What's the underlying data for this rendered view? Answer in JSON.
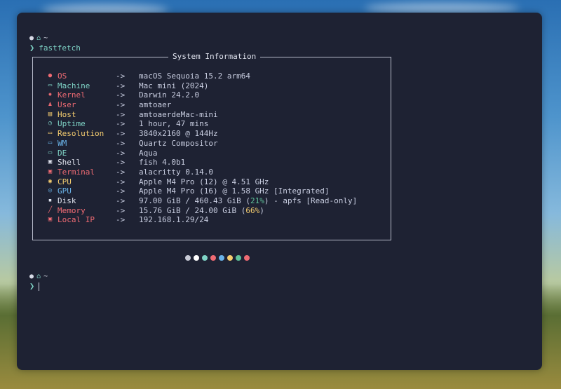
{
  "colors": {
    "terminal_bg": "#1e2233",
    "accent_teal": "#7fd3c6",
    "red": "#ef6b73",
    "yellow": "#f4cc6f",
    "blue": "#6ab3e8",
    "green": "#5fc29a"
  },
  "prompt1": {
    "icons": [
      "apple-icon",
      "home-icon"
    ],
    "dir": "~",
    "command": "fastfetch"
  },
  "box": {
    "title": "System Information"
  },
  "rows": [
    {
      "key": "OS",
      "icon": "apple-icon",
      "color": "#ef6b73",
      "arrow": "->",
      "value": "macOS Sequoia 15.2 arm64"
    },
    {
      "key": "Machine",
      "icon": "monitor-icon",
      "color": "#7fd3c6",
      "arrow": "->",
      "value": "Mac mini (2024)"
    },
    {
      "key": "Kernel",
      "icon": "gear-icon",
      "color": "#ef6b73",
      "arrow": "->",
      "value": "Darwin 24.2.0"
    },
    {
      "key": "User",
      "icon": "user-icon",
      "color": "#ef6b73",
      "arrow": "->",
      "value": "amtoaer"
    },
    {
      "key": "Host",
      "icon": "server-icon",
      "color": "#f4cc6f",
      "arrow": "->",
      "value": "amtoaerdeMac-mini"
    },
    {
      "key": "Uptime",
      "icon": "clock-icon",
      "color": "#7fd3c6",
      "arrow": "->",
      "value": "1 hour, 47 mins"
    },
    {
      "key": "Resolution",
      "icon": "display-icon",
      "color": "#f4cc6f",
      "arrow": "->",
      "value": "3840x2160 @ 144Hz"
    },
    {
      "key": "WM",
      "icon": "window-icon",
      "color": "#6ab3e8",
      "arrow": "->",
      "value": "Quartz Compositor"
    },
    {
      "key": "DE",
      "icon": "desktop-icon",
      "color": "#7fd3c6",
      "arrow": "->",
      "value": "Aqua"
    },
    {
      "key": "Shell",
      "icon": "terminal-icon",
      "color": "#e0e3ee",
      "arrow": "->",
      "value": "fish 4.0b1"
    },
    {
      "key": "Terminal",
      "icon": "terminal-icon",
      "color": "#ef6b73",
      "arrow": "->",
      "value": "alacritty 0.14.0"
    },
    {
      "key": "CPU",
      "icon": "cpu-icon",
      "color": "#f4cc6f",
      "arrow": "->",
      "value": "Apple M4 Pro (12) @ 4.51 GHz"
    },
    {
      "key": "GPU",
      "icon": "gpu-icon",
      "color": "#6ab3e8",
      "arrow": "->",
      "value": "Apple M4 Pro (16) @ 1.58 GHz [Integrated]"
    },
    {
      "key": "Disk",
      "icon": "disk-icon",
      "color": "#e0e3ee",
      "arrow": "->",
      "value_parts": [
        "97.00 GiB / 460.43 GiB (",
        "21%",
        ") - apfs [Read-only]"
      ],
      "highlight_color": "#5fc29a"
    },
    {
      "key": "Memory",
      "icon": "memory-icon",
      "color": "#ef6b73",
      "arrow": "->",
      "value_parts": [
        "15.76 GiB / 24.00 GiB (",
        "66%",
        ")"
      ],
      "highlight_color": "#f4cc6f"
    },
    {
      "key": "Local IP",
      "icon": "network-icon",
      "color": "#ef6b73",
      "arrow": "->",
      "value": "192.168.1.29/24"
    }
  ],
  "palette": [
    "#c8cbd6",
    "#ffffff",
    "#7fd3c6",
    "#ef6b73",
    "#6ab3e8",
    "#f4cc6f",
    "#5fc29a",
    "#ef6b73"
  ],
  "prompt2": {
    "icons": [
      "apple-icon",
      "home-icon"
    ],
    "dir": "~"
  }
}
